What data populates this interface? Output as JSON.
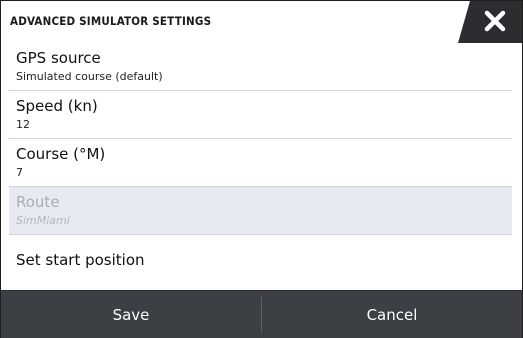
{
  "dialog": {
    "title": "ADVANCED SIMULATOR SETTINGS",
    "close_icon": "close-icon"
  },
  "settings": [
    {
      "label": "GPS source",
      "value": "Simulated course (default)",
      "enabled": true
    },
    {
      "label": "Speed (kn)",
      "value": "12",
      "enabled": true
    },
    {
      "label": "Course (°M)",
      "value": "7",
      "enabled": true
    },
    {
      "label": "Route",
      "value": "SimMiami",
      "enabled": false
    },
    {
      "label": "Set start position",
      "enabled": true
    }
  ],
  "footer": {
    "save_label": "Save",
    "cancel_label": "Cancel"
  },
  "colors": {
    "header_bg": "#ffffff",
    "close_tab_bg": "#2b2d31",
    "footer_bg": "#3c3f44",
    "disabled_row_bg": "#e7eaf0"
  }
}
